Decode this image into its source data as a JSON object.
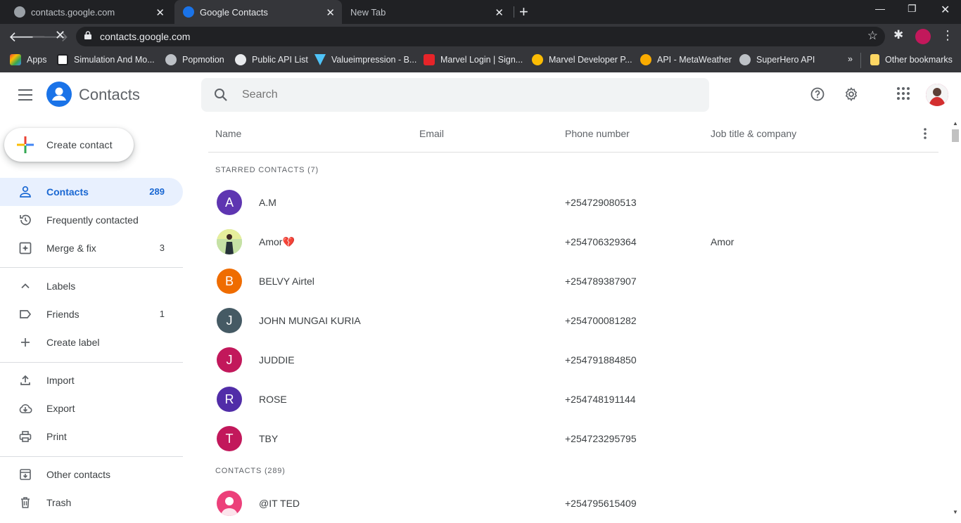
{
  "browser": {
    "tabs": [
      {
        "title": "contacts.google.com",
        "active": false
      },
      {
        "title": "Google Contacts",
        "active": true
      },
      {
        "title": "New Tab",
        "active": false
      }
    ],
    "url": "contacts.google.com",
    "bookmarks": [
      {
        "label": "Apps",
        "color": "#ea4335"
      },
      {
        "label": "Simulation And Mo...",
        "color": "#ffffff"
      },
      {
        "label": "Popmotion",
        "color": "#9aa0a6"
      },
      {
        "label": "Public API List",
        "color": "#e8eaed"
      },
      {
        "label": "Valueimpression - B...",
        "color": "#4fc3f7"
      },
      {
        "label": "Marvel Login | Sign...",
        "color": "#e62429"
      },
      {
        "label": "Marvel Developer P...",
        "color": "#fbbc04"
      },
      {
        "label": "API - MetaWeather",
        "color": "#f9ab00"
      },
      {
        "label": "SuperHero API",
        "color": "#9aa0a6"
      }
    ],
    "bookmarks_overflow": "»",
    "other_bookmarks": "Other bookmarks"
  },
  "header": {
    "title": "Contacts",
    "search_placeholder": "Search"
  },
  "sidebar": {
    "create_label": "Create contact",
    "items": [
      {
        "label": "Contacts",
        "count": "289",
        "icon": "person-icon"
      },
      {
        "label": "Frequently contacted",
        "count": "",
        "icon": "history-icon"
      },
      {
        "label": "Merge & fix",
        "count": "3",
        "icon": "merge-icon"
      }
    ],
    "labels_heading": "Labels",
    "labels": [
      {
        "label": "Friends",
        "count": "1"
      }
    ],
    "create_label_item": "Create label",
    "tools": [
      {
        "label": "Import",
        "icon": "upload-icon"
      },
      {
        "label": "Export",
        "icon": "cloud-download-icon"
      },
      {
        "label": "Print",
        "icon": "print-icon"
      }
    ],
    "bottom": [
      {
        "label": "Other contacts",
        "icon": "archive-icon"
      },
      {
        "label": "Trash",
        "icon": "trash-icon"
      }
    ]
  },
  "table": {
    "columns": [
      "Name",
      "Email",
      "Phone number",
      "Job title & company"
    ],
    "starred_heading": "STARRED CONTACTS (7)",
    "starred": [
      {
        "initial": "A",
        "name": "A.M",
        "phone": "+254729080513",
        "job": "",
        "color": "#5e35b1"
      },
      {
        "initial": "",
        "name": "Amor💔",
        "phone": "+254706329364",
        "job": "Amor",
        "color": "#7cb342"
      },
      {
        "initial": "B",
        "name": "BELVY Airtel",
        "phone": "+254789387907",
        "job": "",
        "color": "#ef6c00"
      },
      {
        "initial": "J",
        "name": "JOHN MUNGAI KURIA",
        "phone": "+254700081282",
        "job": "",
        "color": "#455a64"
      },
      {
        "initial": "J",
        "name": "JUDDIE",
        "phone": "+254791884850",
        "job": "",
        "color": "#c2185b"
      },
      {
        "initial": "R",
        "name": "ROSE",
        "phone": "+254748191144",
        "job": "",
        "color": "#512da8"
      },
      {
        "initial": "T",
        "name": "TBY",
        "phone": "+254723295795",
        "job": "",
        "color": "#c2185b"
      }
    ],
    "contacts_heading": "CONTACTS (289)",
    "contacts": [
      {
        "initial": "",
        "name": "@IT TED",
        "phone": "+254795615409",
        "job": "",
        "color": "#ec407a"
      }
    ]
  }
}
